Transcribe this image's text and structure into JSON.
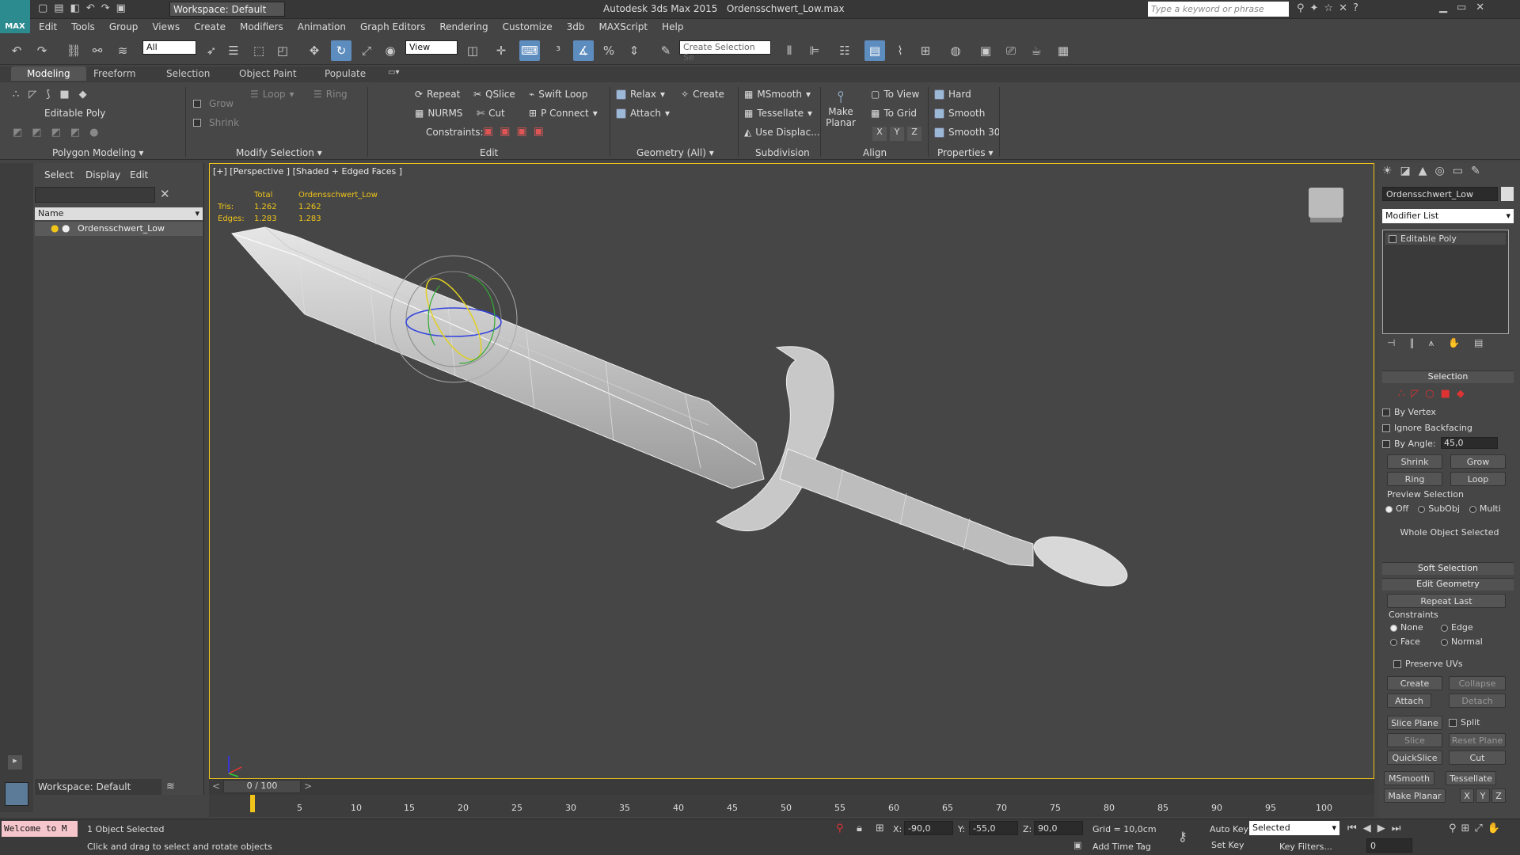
{
  "title": {
    "app": "Autodesk 3ds Max 2015",
    "file": "Ordensschwert_Low.max",
    "workspace": "Workspace: Default",
    "search_placeholder": "Type a keyword or phrase"
  },
  "menu": [
    "Edit",
    "Tools",
    "Group",
    "Views",
    "Create",
    "Modifiers",
    "Animation",
    "Graph Editors",
    "Rendering",
    "Customize",
    "3db",
    "MAXScript",
    "Help"
  ],
  "toolbar": {
    "filter": "All",
    "refcoord": "View",
    "selset": "Create Selection Se"
  },
  "ribbon_tabs": [
    "Modeling",
    "Freeform",
    "Selection",
    "Object Paint",
    "Populate"
  ],
  "ribbon": {
    "poly_mode": "Editable Poly",
    "grow": "Grow",
    "shrink": "Shrink",
    "loop": "Loop",
    "ring": "Ring",
    "repeat": "Repeat",
    "qslice": "QSlice",
    "swift_loop": "Swift Loop",
    "nurms": "NURMS",
    "cut": "Cut",
    "p_connect": "P Connect",
    "constraints": "Constraints:",
    "relax": "Relax",
    "create": "Create",
    "attach": "Attach",
    "msmooth": "MSmooth",
    "tessellate": "Tessellate",
    "use_displac": "Use Displac...",
    "make": "Make",
    "planar": "Planar",
    "to_view": "To View",
    "to_grid": "To Grid",
    "x": "X",
    "y": "Y",
    "z": "Z",
    "hard": "Hard",
    "smooth": "Smooth",
    "smooth30": "Smooth 30",
    "groups": [
      "Polygon Modeling",
      "Modify Selection",
      "Edit",
      "Geometry (All)",
      "Subdivision",
      "Align",
      "Properties"
    ]
  },
  "explorer": {
    "tabs": [
      "Select",
      "Display",
      "Edit"
    ],
    "col_name": "Name",
    "object": "Ordensschwert_Low",
    "workspace": "Workspace: Default"
  },
  "viewport": {
    "label": "[+] [Perspective ] [Shaded + Edged Faces ]",
    "stats_total": "Total",
    "stats_obj": "Ordensschwert_Low",
    "tris_label": "Tris:",
    "tris_total": "1.262",
    "tris_obj": "1.262",
    "edges_label": "Edges:",
    "edges_total": "1.283",
    "edges_obj": "1.283"
  },
  "command_panel": {
    "object_name": "Ordensschwert_Low",
    "modifier_list": "Modifier List",
    "stack_item": "Editable Poly",
    "selection": "Selection",
    "by_vertex": "By Vertex",
    "ignore_backfacing": "Ignore Backfacing",
    "by_angle": "By Angle:",
    "angle_value": "45,0",
    "shrink": "Shrink",
    "grow": "Grow",
    "ring": "Ring",
    "loop": "Loop",
    "preview_selection": "Preview Selection",
    "off": "Off",
    "subobj": "SubObj",
    "multi": "Multi",
    "whole_object": "Whole Object Selected",
    "soft_selection": "Soft Selection",
    "edit_geometry": "Edit Geometry",
    "repeat_last": "Repeat Last",
    "constraints": "Constraints",
    "none": "None",
    "edge": "Edge",
    "face": "Face",
    "normal": "Normal",
    "preserve_uvs": "Preserve UVs",
    "create": "Create",
    "collapse": "Collapse",
    "attach": "Attach",
    "detach": "Detach",
    "slice_plane": "Slice Plane",
    "split": "Split",
    "slice": "Slice",
    "reset_plane": "Reset Plane",
    "quickslice": "QuickSlice",
    "cut": "Cut",
    "msmooth": "MSmooth",
    "tessellate": "Tessellate",
    "make_planar": "Make Planar",
    "x": "X",
    "y": "Y",
    "z": "Z"
  },
  "timeline": {
    "frame": "0 / 100",
    "ticks": [
      "5",
      "10",
      "15",
      "20",
      "25",
      "30",
      "35",
      "40",
      "45",
      "50",
      "55",
      "60",
      "65",
      "70",
      "75",
      "80",
      "85",
      "90",
      "95",
      "100"
    ]
  },
  "status": {
    "maxscript": "Welcome to M",
    "selected": "1 Object Selected",
    "hint": "Click and drag to select and rotate objects",
    "x_label": "X:",
    "x_val": "-90,0",
    "y_label": "Y:",
    "y_val": "-55,0",
    "z_label": "Z:",
    "z_val": "90,0",
    "grid": "Grid = 10,0cm",
    "add_time_tag": "Add Time Tag",
    "auto_key": "Auto Key",
    "set_key": "Set Key",
    "key_mode": "Selected",
    "key_filters": "Key Filters...",
    "frame_field": "0"
  }
}
